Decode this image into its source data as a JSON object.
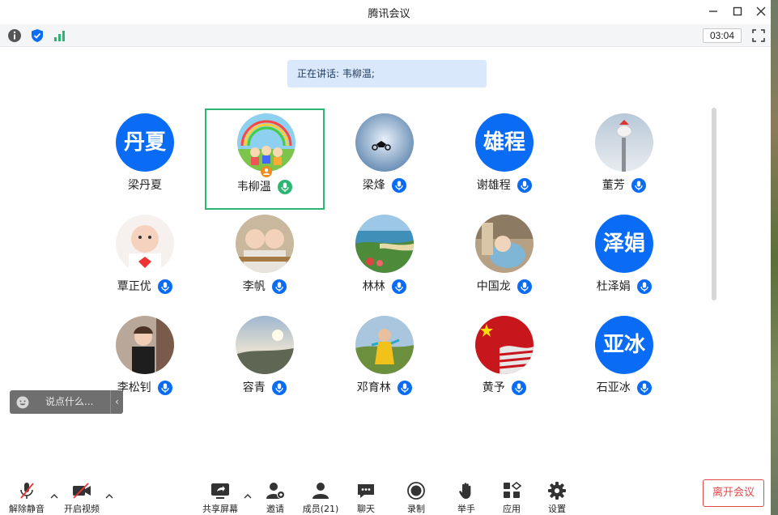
{
  "window": {
    "title": "腾讯会议"
  },
  "infobar": {
    "timer": "03:04"
  },
  "speaking": {
    "text": "正在讲话: 韦柳温;"
  },
  "participants": [
    {
      "name": "梁丹夏",
      "avatar_text": "丹夏"
    },
    {
      "name": "韦柳温",
      "avatar_text": ""
    },
    {
      "name": "梁烽",
      "avatar_text": ""
    },
    {
      "name": "谢雄程",
      "avatar_text": "雄程"
    },
    {
      "name": "董芳",
      "avatar_text": ""
    },
    {
      "name": "覃正优",
      "avatar_text": ""
    },
    {
      "name": "李帆",
      "avatar_text": ""
    },
    {
      "name": "林林",
      "avatar_text": ""
    },
    {
      "name": "中国龙",
      "avatar_text": ""
    },
    {
      "name": "杜泽娟",
      "avatar_text": "泽娟"
    },
    {
      "name": "李松钊",
      "avatar_text": ""
    },
    {
      "name": "容青",
      "avatar_text": ""
    },
    {
      "name": "邓育林",
      "avatar_text": ""
    },
    {
      "name": "黄予",
      "avatar_text": ""
    },
    {
      "name": "石亚冰",
      "avatar_text": "亚冰"
    }
  ],
  "chat": {
    "placeholder": "说点什么..."
  },
  "toolbar": {
    "unmute": "解除静音",
    "video": "开启视频",
    "share": "共享屏幕",
    "invite": "邀请",
    "members": "成员(21)",
    "chat": "聊天",
    "record": "录制",
    "raise_hand": "举手",
    "apps": "应用",
    "settings": "设置",
    "leave": "离开会议"
  },
  "colors": {
    "accent": "#0a6cf5",
    "active_border": "#2bb673",
    "leave": "#e24a4a",
    "speaking_bg": "#d9e8fb"
  }
}
